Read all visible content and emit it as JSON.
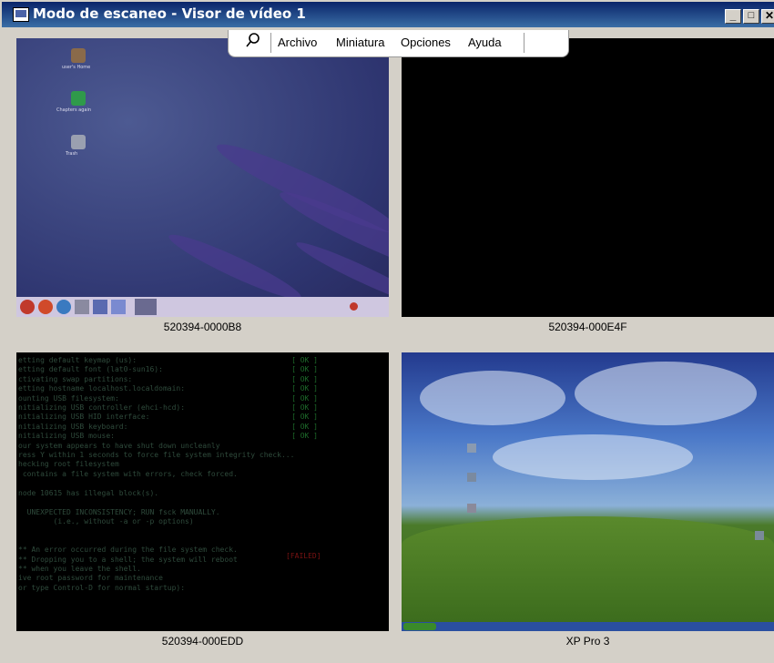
{
  "window": {
    "title": "Modo de escaneo - Visor de vídeo 1"
  },
  "title_buttons": {
    "minimize": "_",
    "maximize": "□",
    "close": "✕"
  },
  "menu": {
    "items": [
      "Archivo",
      "Miniatura",
      "Opciones",
      "Ayuda"
    ],
    "pin_icon": "pushpin-icon"
  },
  "thumbnails": [
    {
      "label": "520394-0000B8"
    },
    {
      "label": "520394-000E4F"
    },
    {
      "label": "520394-000EDD"
    },
    {
      "label": "XP Pro 3"
    }
  ],
  "linux_desktop": {
    "icons": [
      "user's Home",
      "Chapters again",
      "Trash"
    ]
  },
  "console": {
    "lines": [
      "etting default keymap (us):",
      "etting default font (lat0-sun16):",
      "ctivating swap partitions:",
      "etting hostname localhost.localdomain:",
      "ounting USB filesystem:",
      "nitializing USB controller (ehci-hcd):",
      "nitializing USB HID interface:",
      "nitializing USB keyboard:",
      "nitializing USB mouse:",
      "our system appears to have shut down uncleanly",
      "ress Y within 1 seconds to force file system integrity check...",
      "hecking root filesystem",
      " contains a file system with errors, check forced.",
      "",
      "node 10615 has illegal block(s).",
      "",
      "  UNEXPECTED INCONSISTENCY; RUN fsck MANUALLY.",
      "        (i.e., without -a or -p options)",
      "",
      "",
      "** An error occurred during the file system check.",
      "** Dropping you to a shell; the system will reboot",
      "** when you leave the shell.",
      "ive root password for maintenance",
      "or type Control-D for normal startup):"
    ],
    "ok_text": "[  OK  ]",
    "failed_text": "[FAILED]"
  }
}
